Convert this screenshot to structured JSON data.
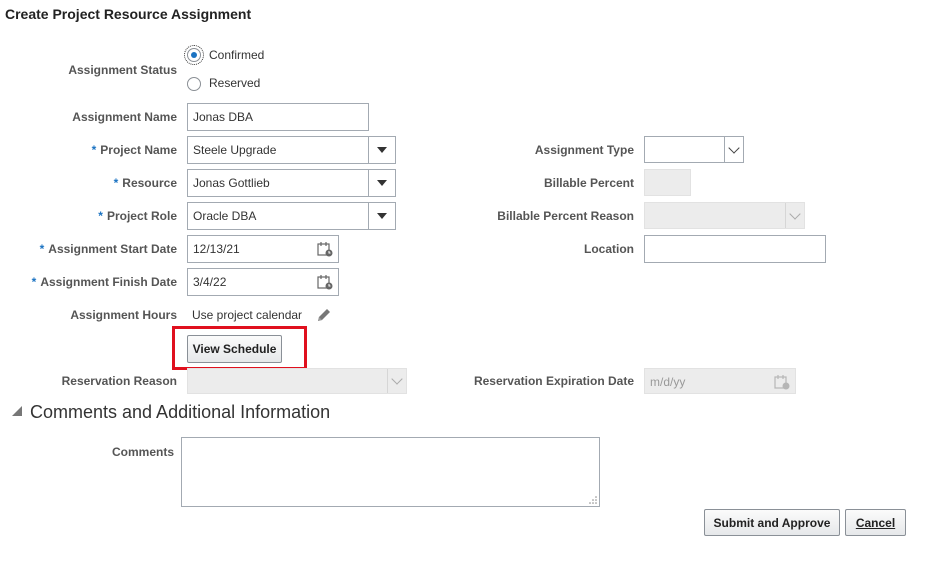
{
  "page_title": "Create Project Resource Assignment",
  "assignment_status": {
    "label": "Assignment Status",
    "options": [
      {
        "label": "Confirmed",
        "selected": true
      },
      {
        "label": "Reserved",
        "selected": false
      }
    ]
  },
  "assignment_name": {
    "label": "Assignment Name",
    "value": "Jonas DBA"
  },
  "project_name": {
    "label": "Project Name",
    "value": "Steele Upgrade",
    "required": "*"
  },
  "resource": {
    "label": "Resource",
    "value": "Jonas Gottlieb",
    "required": "*"
  },
  "project_role": {
    "label": "Project Role",
    "value": "Oracle DBA",
    "required": "*"
  },
  "start_date": {
    "label": "Assignment Start Date",
    "value": "12/13/21",
    "required": "*"
  },
  "finish_date": {
    "label": "Assignment Finish Date",
    "value": "3/4/22",
    "required": "*"
  },
  "assignment_hours": {
    "label": "Assignment Hours",
    "value": "Use project calendar"
  },
  "view_schedule_label": "View Schedule",
  "reservation_reason": {
    "label": "Reservation Reason",
    "value": ""
  },
  "assignment_type": {
    "label": "Assignment Type",
    "value": ""
  },
  "billable_percent": {
    "label": "Billable Percent",
    "value": ""
  },
  "billable_percent_reason": {
    "label": "Billable Percent Reason",
    "value": ""
  },
  "location": {
    "label": "Location",
    "value": ""
  },
  "reservation_expiration": {
    "label": "Reservation Expiration Date",
    "placeholder": "m/d/yy"
  },
  "comments_section": {
    "title": "Comments and Additional Information"
  },
  "comments": {
    "label": "Comments",
    "value": ""
  },
  "buttons": {
    "submit": "Submit and Approve",
    "cancel": "Cancel"
  },
  "colors": {
    "accent": "#1b73c2",
    "highlight_box": "#e0101e",
    "label": "#555555"
  }
}
